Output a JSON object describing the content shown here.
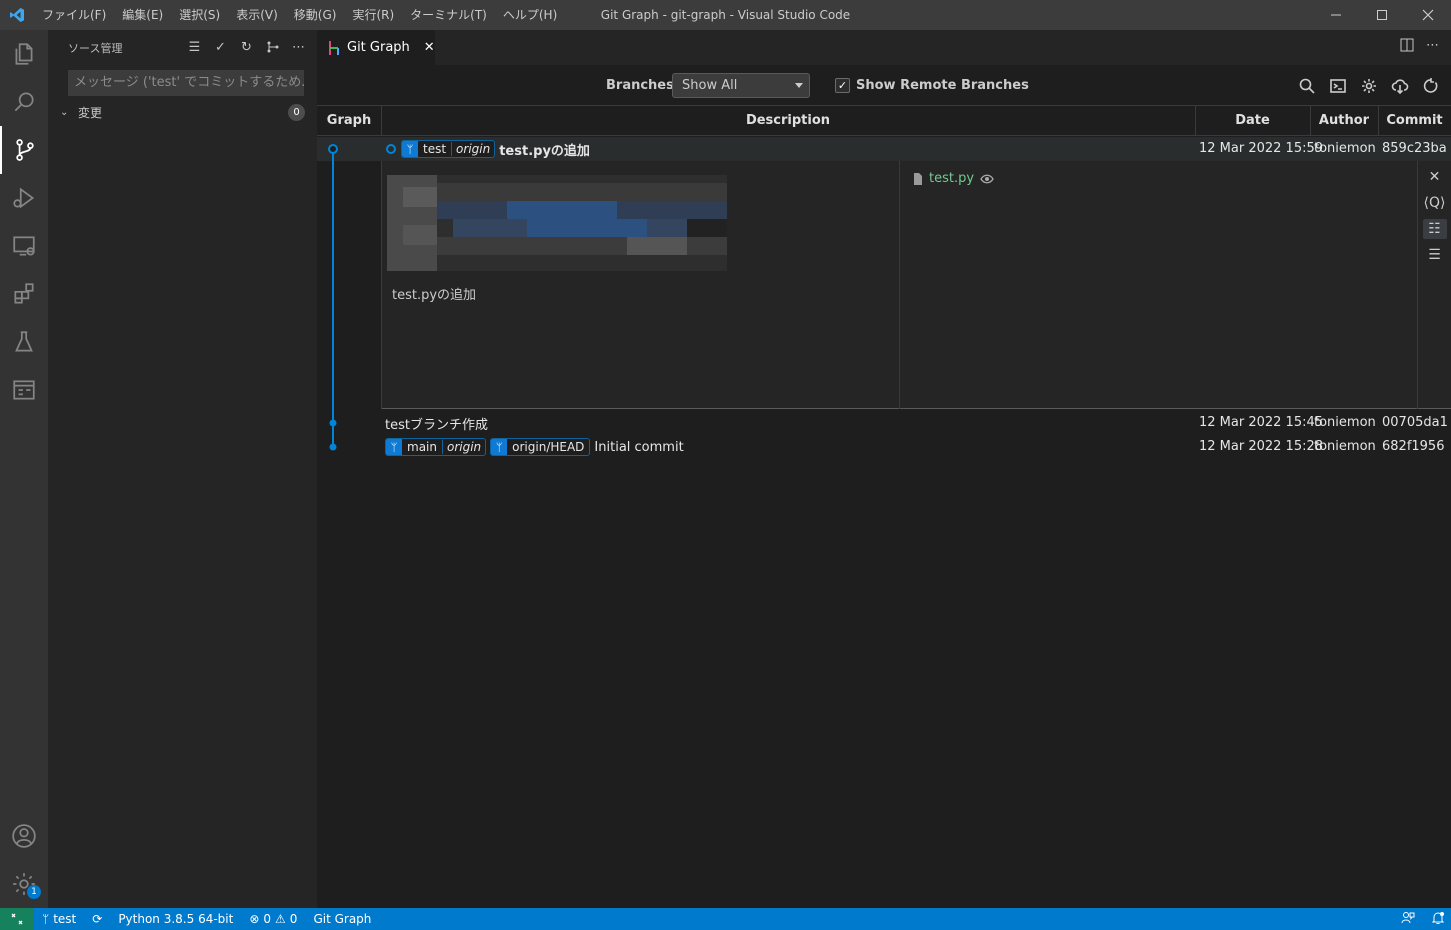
{
  "app": {
    "title": "Git Graph - git-graph - Visual Studio Code",
    "menu": [
      "ファイル(F)",
      "編集(E)",
      "選択(S)",
      "表示(V)",
      "移動(G)",
      "実行(R)",
      "ターミナル(T)",
      "ヘルプ(H)"
    ]
  },
  "sidebar": {
    "title": "ソース管理",
    "commit_placeholder": "メッセージ ('test' でコミットするため...",
    "changes_label": "変更",
    "changes_count": "0"
  },
  "tab": {
    "label": "Git Graph"
  },
  "controls": {
    "branches_label": "Branches:",
    "branches_value": "Show All",
    "show_remote_label": "Show Remote Branches",
    "show_remote_checked": true
  },
  "table": {
    "headers": {
      "graph": "Graph",
      "description": "Description",
      "date": "Date",
      "author": "Author",
      "commit": "Commit"
    },
    "rows": [
      {
        "refs": [
          {
            "name": "test",
            "remote": "origin"
          }
        ],
        "message": "test.pyの追加",
        "date": "12 Mar 2022 15:59",
        "author": "toniemon",
        "commit": "859c23ba"
      },
      {
        "refs": [],
        "message": "testブランチ作成",
        "date": "12 Mar 2022 15:45",
        "author": "toniemon",
        "commit": "00705da1"
      },
      {
        "refs": [
          {
            "name": "main",
            "remote": "origin"
          },
          {
            "name": "origin/HEAD"
          }
        ],
        "message": "Initial commit",
        "date": "12 Mar 2022 15:28",
        "author": "toniemon",
        "commit": "682f1956"
      }
    ]
  },
  "detail": {
    "message": "test.pyの追加",
    "files": [
      {
        "name": "test.py",
        "status_color": "#73c991"
      }
    ]
  },
  "statusbar": {
    "branch": "test",
    "python": "Python 3.8.5 64-bit",
    "errors": "0",
    "warnings": "0",
    "git_graph": "Git Graph"
  },
  "colors": {
    "accent": "#007acc",
    "graph_line": "#0085d9",
    "remote_indicator": "#16825d"
  }
}
